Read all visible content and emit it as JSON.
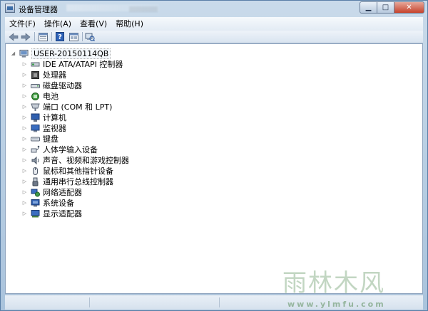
{
  "window": {
    "title": "设备管理器",
    "minimize_glyph": "▁",
    "maximize_glyph": "□",
    "close_glyph": "✕"
  },
  "menu": [
    "文件(F)",
    "操作(A)",
    "查看(V)",
    "帮助(H)"
  ],
  "toolbar": {
    "buttons": [
      "back-icon",
      "forward-icon",
      "properties-icon",
      "help-icon",
      "view-icon",
      "scan-hardware-icon"
    ]
  },
  "tree": {
    "root": "USER-20150114QB",
    "items": [
      {
        "label": "IDE ATA/ATAPI 控制器",
        "icon": "ide-controller-icon"
      },
      {
        "label": "处理器",
        "icon": "processor-icon"
      },
      {
        "label": "磁盘驱动器",
        "icon": "disk-drive-icon"
      },
      {
        "label": "电池",
        "icon": "battery-icon"
      },
      {
        "label": "端口 (COM 和 LPT)",
        "icon": "port-icon"
      },
      {
        "label": "计算机",
        "icon": "computer-icon"
      },
      {
        "label": "监视器",
        "icon": "monitor-icon"
      },
      {
        "label": "键盘",
        "icon": "keyboard-icon"
      },
      {
        "label": "人体学输入设备",
        "icon": "hid-icon"
      },
      {
        "label": "声音、视频和游戏控制器",
        "icon": "sound-icon"
      },
      {
        "label": "鼠标和其他指针设备",
        "icon": "mouse-icon"
      },
      {
        "label": "通用串行总线控制器",
        "icon": "usb-icon"
      },
      {
        "label": "网络适配器",
        "icon": "network-adapter-icon"
      },
      {
        "label": "系统设备",
        "icon": "system-device-icon"
      },
      {
        "label": "显示适配器",
        "icon": "display-adapter-icon"
      }
    ]
  },
  "watermark": {
    "text": "雨林木风",
    "sub": "www.ylmfu.com"
  }
}
